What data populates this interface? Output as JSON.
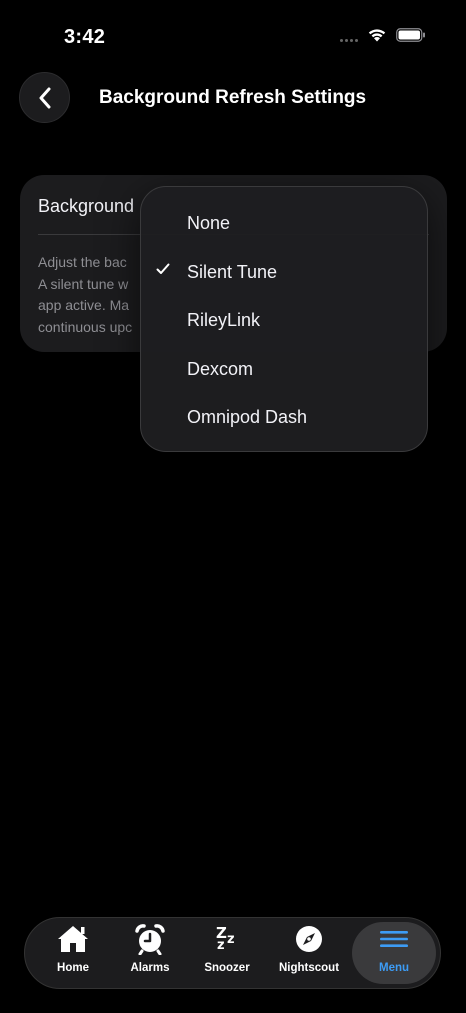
{
  "status_bar": {
    "time": "3:42"
  },
  "header": {
    "title": "Background Refresh Settings"
  },
  "card": {
    "label": "Background",
    "description": "Adjust the bac\nA silent tune w\napp active. Ma\ncontinuous upc"
  },
  "dropdown": {
    "items": [
      {
        "label": "None",
        "selected": false
      },
      {
        "label": "Silent Tune",
        "selected": true
      },
      {
        "label": "RileyLink",
        "selected": false
      },
      {
        "label": "Dexcom",
        "selected": false
      },
      {
        "label": "Omnipod Dash",
        "selected": false
      }
    ]
  },
  "tab_bar": {
    "tabs": [
      {
        "label": "Home",
        "icon": "house-icon"
      },
      {
        "label": "Alarms",
        "icon": "alarm-clock-icon"
      },
      {
        "label": "Snoozer",
        "icon": "zzz-icon"
      },
      {
        "label": "Nightscout",
        "icon": "compass-icon"
      },
      {
        "label": "Menu",
        "icon": "menu-lines-icon",
        "active": true
      }
    ],
    "active_color": "#3d9cf5"
  }
}
